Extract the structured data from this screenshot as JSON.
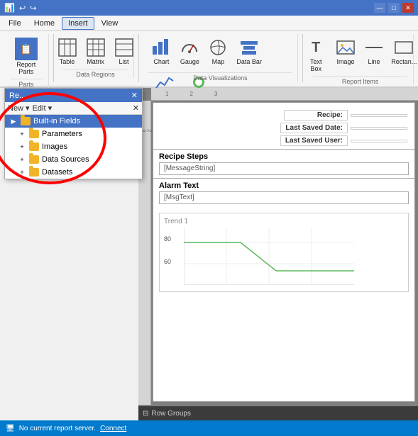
{
  "titleBar": {
    "icon": "📊",
    "controls": [
      "—",
      "□",
      "✕"
    ]
  },
  "menuBar": {
    "items": [
      "File",
      "Home",
      "Insert",
      "View"
    ],
    "activeIndex": 2
  },
  "ribbon": {
    "groups": [
      {
        "label": "Parts",
        "items": [
          {
            "icon": "📋",
            "label": "Report\nParts"
          }
        ]
      },
      {
        "label": "Data Regions",
        "items": [
          {
            "icon": "⊞",
            "label": "Table"
          },
          {
            "icon": "⊟",
            "label": "Matrix"
          },
          {
            "icon": "☰",
            "label": "List"
          }
        ]
      },
      {
        "label": "Data Visualizations",
        "items": [
          {
            "icon": "📊",
            "label": "Chart"
          },
          {
            "icon": "🔵",
            "label": "Gauge"
          },
          {
            "icon": "🗺",
            "label": "Map"
          },
          {
            "icon": "📊",
            "label": "Data\nBar"
          },
          {
            "icon": "📈",
            "label": "Sparkline"
          },
          {
            "icon": "●",
            "label": "Indicator"
          }
        ]
      },
      {
        "label": "Report Items",
        "items": [
          {
            "icon": "T",
            "label": "Text\nBox"
          },
          {
            "icon": "🖼",
            "label": "Image"
          },
          {
            "icon": "—",
            "label": "Line"
          },
          {
            "icon": "▭",
            "label": "Rectan..."
          }
        ]
      }
    ]
  },
  "sidePanel": {
    "title": "Re...",
    "toolbar": {
      "items": [
        "New ▾",
        "Edit ▾",
        "✕"
      ]
    },
    "tree": [
      {
        "id": "built-in-fields",
        "label": "Built-in Fields",
        "level": 0,
        "selected": true,
        "expandable": true
      },
      {
        "id": "parameters",
        "label": "Parameters",
        "level": 1,
        "selected": false,
        "expandable": true
      },
      {
        "id": "images",
        "label": "Images",
        "level": 1,
        "selected": false,
        "expandable": true
      },
      {
        "id": "data-sources",
        "label": "Data Sources",
        "level": 1,
        "selected": false,
        "expandable": true
      },
      {
        "id": "datasets",
        "label": "Datasets",
        "level": 1,
        "selected": false,
        "expandable": true
      }
    ]
  },
  "reportContent": {
    "headerFields": [
      {
        "label": "Recipe:",
        "value": ""
      },
      {
        "label": "Last Saved Date:",
        "value": ""
      },
      {
        "label": "Last Saved User:",
        "value": ""
      }
    ],
    "sections": [
      {
        "title": "Recipe Steps",
        "field": "[MessageString]"
      },
      {
        "title": "Alarm Text",
        "field": "[MsgText]"
      }
    ],
    "chart": {
      "title": "Trend 1",
      "yLabels": [
        "80",
        "60"
      ],
      "yPositions": [
        30,
        60
      ]
    }
  },
  "rowGroups": {
    "label": "Row Groups"
  },
  "statusBar": {
    "text": "No current report server.",
    "linkText": "Connect"
  },
  "ruler": {
    "ticks": [
      "1",
      "2",
      "3"
    ]
  }
}
